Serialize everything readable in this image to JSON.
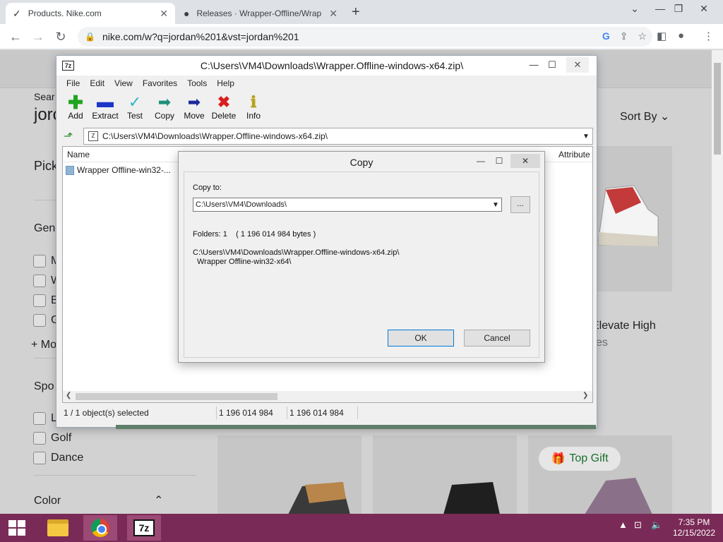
{
  "browser": {
    "tabs": [
      {
        "title": "Products. Nike.com"
      },
      {
        "title": "Releases · Wrapper-Offline/Wrap"
      }
    ],
    "url": "nike.com/w?q=jordan%201&vst=jordan%201"
  },
  "nike_page": {
    "search_prefix": "Sear",
    "search_heading": "jorc",
    "pick_label": "Pick",
    "sort_by": "Sort By",
    "gender_label": "Gen",
    "gender_options": [
      "M",
      "W",
      "B",
      "G"
    ],
    "more_link": "+ Mo",
    "sport_label": "Spo",
    "sport_options": [
      "L",
      "Golf",
      "Dance"
    ],
    "color_label": "Color",
    "product_name": "Elevate High",
    "product_sub": "es",
    "top_gift": "Top Gift"
  },
  "sevenzip": {
    "title": "C:\\Users\\VM4\\Downloads\\Wrapper.Offline-windows-x64.zip\\",
    "menu": [
      "File",
      "Edit",
      "View",
      "Favorites",
      "Tools",
      "Help"
    ],
    "tools": [
      {
        "label": "Add",
        "icon": "add-icon"
      },
      {
        "label": "Extract",
        "icon": "extract-icon"
      },
      {
        "label": "Test",
        "icon": "test-icon"
      },
      {
        "label": "Copy",
        "icon": "copy-icon"
      },
      {
        "label": "Move",
        "icon": "move-icon"
      },
      {
        "label": "Delete",
        "icon": "delete-icon"
      },
      {
        "label": "Info",
        "icon": "info-icon"
      }
    ],
    "path": "C:\\Users\\VM4\\Downloads\\Wrapper.Offline-windows-x64.zip\\",
    "columns": {
      "name": "Name",
      "attributes": "Attribute"
    },
    "files": [
      {
        "name": "Wrapper Offline-win32-..."
      }
    ],
    "status": {
      "selected": "1 / 1 object(s) selected",
      "size": "1 196 014 984",
      "packed": "1 196 014 984"
    }
  },
  "copy_dialog": {
    "title": "Copy",
    "copy_to_label": "Copy to:",
    "destination": "C:\\Users\\VM4\\Downloads\\",
    "browse_label": "...",
    "folders_info": "Folders: 1    ( 1 196 014 984 bytes )",
    "source_path": "C:\\Users\\VM4\\Downloads\\Wrapper.Offline-windows-x64.zip\\",
    "source_item": "Wrapper Offline-win32-x64\\",
    "ok_label": "OK",
    "cancel_label": "Cancel"
  },
  "taskbar": {
    "time": "7:35 PM",
    "date": "12/15/2022"
  }
}
